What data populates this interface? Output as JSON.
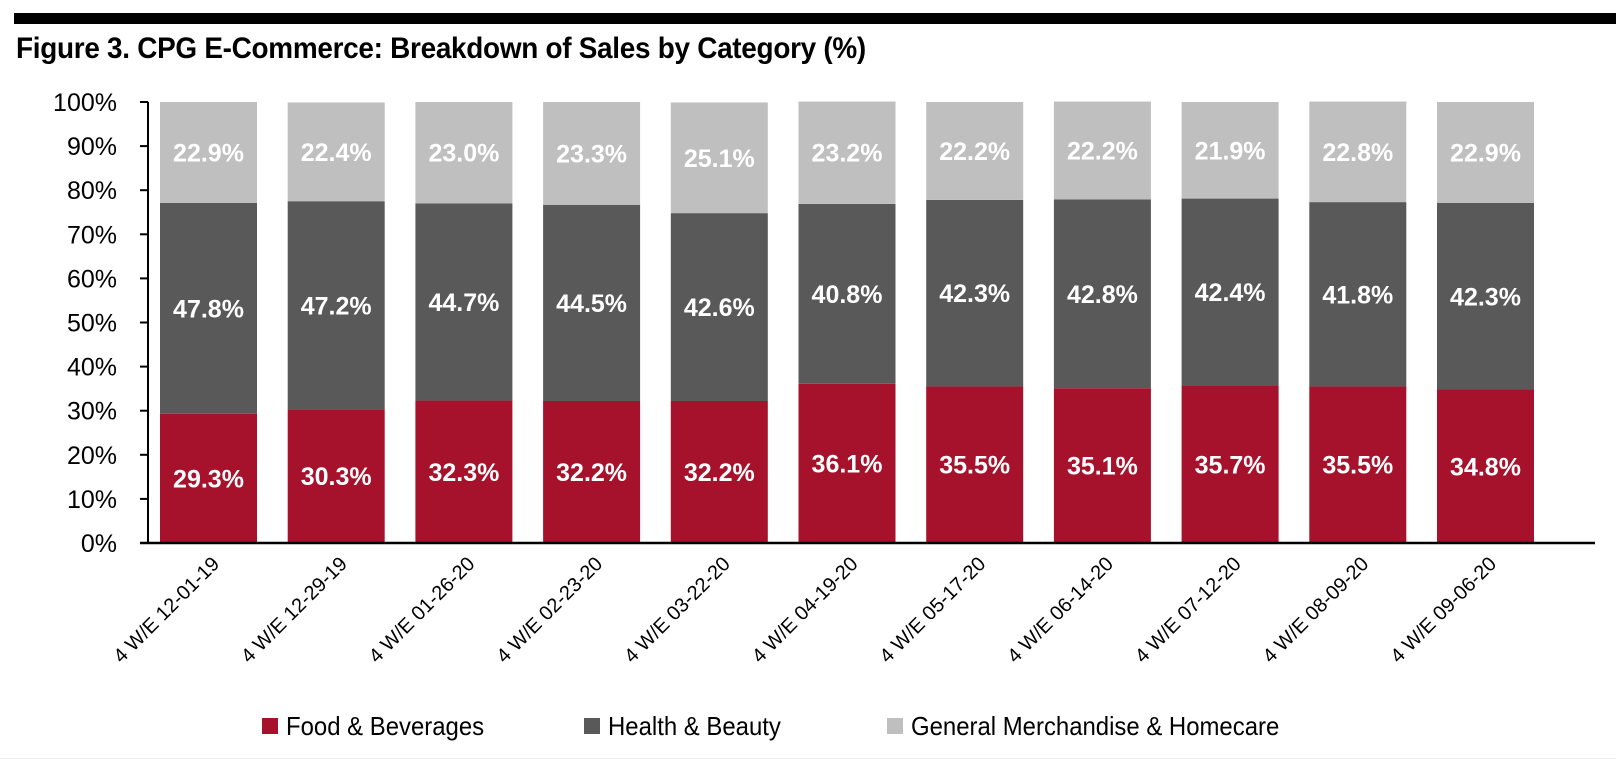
{
  "figure": {
    "title": "Figure 3. CPG E-Commerce: Breakdown of Sales by Category (%)"
  },
  "colors": {
    "food_beverages": "#A6122B",
    "health_beauty": "#595959",
    "general_merchandise": "#BFBFBF",
    "axis": "#000000",
    "data_label": "#FFFFFF"
  },
  "chart_data": {
    "type": "bar",
    "stacked": true,
    "title": "Figure 3. CPG E-Commerce: Breakdown of Sales by Category (%)",
    "xlabel": "",
    "ylabel": "",
    "ylim": [
      0,
      100
    ],
    "yticks": [
      "0%",
      "10%",
      "20%",
      "30%",
      "40%",
      "50%",
      "60%",
      "70%",
      "80%",
      "90%",
      "100%"
    ],
    "grid": false,
    "legend_position": "bottom",
    "categories": [
      "4 W/E 12-01-19",
      "4 W/E 12-29-19",
      "4 W/E 01-26-20",
      "4 W/E 02-23-20",
      "4 W/E 03-22-20",
      "4 W/E 04-19-20",
      "4 W/E 05-17-20",
      "4 W/E 06-14-20",
      "4 W/E 07-12-20",
      "4 W/E 08-09-20",
      "4 W/E 09-06-20"
    ],
    "series": [
      {
        "name": "Food & Beverages",
        "color": "#A6122B",
        "values": [
          29.3,
          30.3,
          32.3,
          32.2,
          32.2,
          36.1,
          35.5,
          35.1,
          35.7,
          35.5,
          34.8
        ]
      },
      {
        "name": "Health & Beauty",
        "color": "#595959",
        "values": [
          47.8,
          47.2,
          44.7,
          44.5,
          42.6,
          40.8,
          42.3,
          42.8,
          42.4,
          41.8,
          42.3
        ]
      },
      {
        "name": "General Merchandise & Homecare",
        "color": "#BFBFBF",
        "values": [
          22.9,
          22.4,
          23.0,
          23.3,
          25.1,
          23.2,
          22.2,
          22.2,
          21.9,
          22.8,
          22.9
        ]
      }
    ],
    "data_label_format": "{v}%"
  },
  "legend": {
    "items": [
      {
        "label": "Food & Beverages"
      },
      {
        "label": "Health & Beauty"
      },
      {
        "label": "General Merchandise & Homecare"
      }
    ]
  }
}
